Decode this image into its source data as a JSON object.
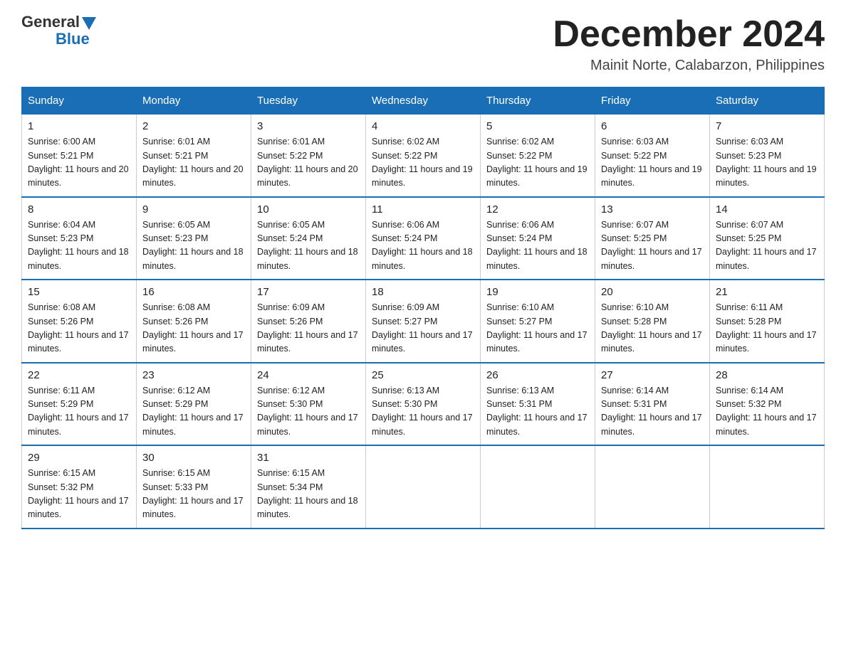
{
  "header": {
    "title": "December 2024",
    "location": "Mainit Norte, Calabarzon, Philippines",
    "logo_general": "General",
    "logo_blue": "Blue"
  },
  "days_of_week": [
    "Sunday",
    "Monday",
    "Tuesday",
    "Wednesday",
    "Thursday",
    "Friday",
    "Saturday"
  ],
  "weeks": [
    [
      {
        "day": "1",
        "sunrise": "6:00 AM",
        "sunset": "5:21 PM",
        "daylight": "11 hours and 20 minutes."
      },
      {
        "day": "2",
        "sunrise": "6:01 AM",
        "sunset": "5:21 PM",
        "daylight": "11 hours and 20 minutes."
      },
      {
        "day": "3",
        "sunrise": "6:01 AM",
        "sunset": "5:22 PM",
        "daylight": "11 hours and 20 minutes."
      },
      {
        "day": "4",
        "sunrise": "6:02 AM",
        "sunset": "5:22 PM",
        "daylight": "11 hours and 19 minutes."
      },
      {
        "day": "5",
        "sunrise": "6:02 AM",
        "sunset": "5:22 PM",
        "daylight": "11 hours and 19 minutes."
      },
      {
        "day": "6",
        "sunrise": "6:03 AM",
        "sunset": "5:22 PM",
        "daylight": "11 hours and 19 minutes."
      },
      {
        "day": "7",
        "sunrise": "6:03 AM",
        "sunset": "5:23 PM",
        "daylight": "11 hours and 19 minutes."
      }
    ],
    [
      {
        "day": "8",
        "sunrise": "6:04 AM",
        "sunset": "5:23 PM",
        "daylight": "11 hours and 18 minutes."
      },
      {
        "day": "9",
        "sunrise": "6:05 AM",
        "sunset": "5:23 PM",
        "daylight": "11 hours and 18 minutes."
      },
      {
        "day": "10",
        "sunrise": "6:05 AM",
        "sunset": "5:24 PM",
        "daylight": "11 hours and 18 minutes."
      },
      {
        "day": "11",
        "sunrise": "6:06 AM",
        "sunset": "5:24 PM",
        "daylight": "11 hours and 18 minutes."
      },
      {
        "day": "12",
        "sunrise": "6:06 AM",
        "sunset": "5:24 PM",
        "daylight": "11 hours and 18 minutes."
      },
      {
        "day": "13",
        "sunrise": "6:07 AM",
        "sunset": "5:25 PM",
        "daylight": "11 hours and 17 minutes."
      },
      {
        "day": "14",
        "sunrise": "6:07 AM",
        "sunset": "5:25 PM",
        "daylight": "11 hours and 17 minutes."
      }
    ],
    [
      {
        "day": "15",
        "sunrise": "6:08 AM",
        "sunset": "5:26 PM",
        "daylight": "11 hours and 17 minutes."
      },
      {
        "day": "16",
        "sunrise": "6:08 AM",
        "sunset": "5:26 PM",
        "daylight": "11 hours and 17 minutes."
      },
      {
        "day": "17",
        "sunrise": "6:09 AM",
        "sunset": "5:26 PM",
        "daylight": "11 hours and 17 minutes."
      },
      {
        "day": "18",
        "sunrise": "6:09 AM",
        "sunset": "5:27 PM",
        "daylight": "11 hours and 17 minutes."
      },
      {
        "day": "19",
        "sunrise": "6:10 AM",
        "sunset": "5:27 PM",
        "daylight": "11 hours and 17 minutes."
      },
      {
        "day": "20",
        "sunrise": "6:10 AM",
        "sunset": "5:28 PM",
        "daylight": "11 hours and 17 minutes."
      },
      {
        "day": "21",
        "sunrise": "6:11 AM",
        "sunset": "5:28 PM",
        "daylight": "11 hours and 17 minutes."
      }
    ],
    [
      {
        "day": "22",
        "sunrise": "6:11 AM",
        "sunset": "5:29 PM",
        "daylight": "11 hours and 17 minutes."
      },
      {
        "day": "23",
        "sunrise": "6:12 AM",
        "sunset": "5:29 PM",
        "daylight": "11 hours and 17 minutes."
      },
      {
        "day": "24",
        "sunrise": "6:12 AM",
        "sunset": "5:30 PM",
        "daylight": "11 hours and 17 minutes."
      },
      {
        "day": "25",
        "sunrise": "6:13 AM",
        "sunset": "5:30 PM",
        "daylight": "11 hours and 17 minutes."
      },
      {
        "day": "26",
        "sunrise": "6:13 AM",
        "sunset": "5:31 PM",
        "daylight": "11 hours and 17 minutes."
      },
      {
        "day": "27",
        "sunrise": "6:14 AM",
        "sunset": "5:31 PM",
        "daylight": "11 hours and 17 minutes."
      },
      {
        "day": "28",
        "sunrise": "6:14 AM",
        "sunset": "5:32 PM",
        "daylight": "11 hours and 17 minutes."
      }
    ],
    [
      {
        "day": "29",
        "sunrise": "6:15 AM",
        "sunset": "5:32 PM",
        "daylight": "11 hours and 17 minutes."
      },
      {
        "day": "30",
        "sunrise": "6:15 AM",
        "sunset": "5:33 PM",
        "daylight": "11 hours and 17 minutes."
      },
      {
        "day": "31",
        "sunrise": "6:15 AM",
        "sunset": "5:34 PM",
        "daylight": "11 hours and 18 minutes."
      },
      null,
      null,
      null,
      null
    ]
  ],
  "labels": {
    "sunrise_prefix": "Sunrise: ",
    "sunset_prefix": "Sunset: ",
    "daylight_prefix": "Daylight: "
  }
}
